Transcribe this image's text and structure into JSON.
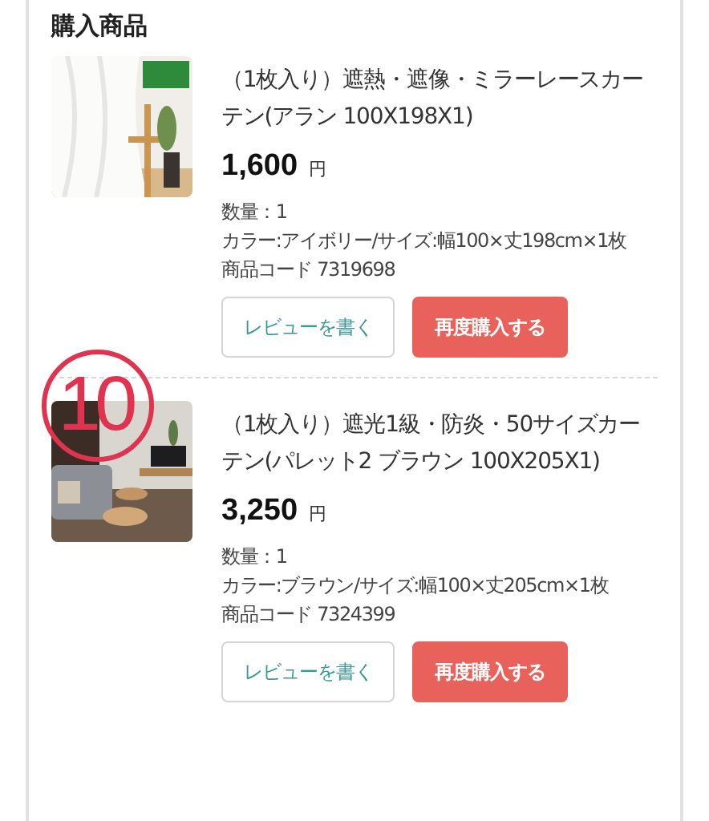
{
  "section_title": "購入商品",
  "annotation": {
    "label": "10"
  },
  "items": [
    {
      "kind": "lace",
      "title": "（1枚入り）遮熱・遮像・ミラーレースカーテン(アラン 100X198X1)",
      "price": "1,600",
      "currency": "円",
      "details": [
        "数量：1",
        "カラー:アイボリー/サイズ:幅100×丈198cm×1枚",
        "商品コード 7319698"
      ],
      "review_button": "レビューを書く",
      "rebuy_button": "再度購入する"
    },
    {
      "kind": "room",
      "title": "（1枚入り）遮光1級・防炎・50サイズカーテン(パレット2 ブラウン 100X205X1)",
      "price": "3,250",
      "currency": "円",
      "details": [
        "数量：1",
        "カラー:ブラウン/サイズ:幅100×丈205cm×1枚",
        "商品コード 7324399"
      ],
      "review_button": "レビューを書く",
      "rebuy_button": "再度購入する"
    }
  ]
}
